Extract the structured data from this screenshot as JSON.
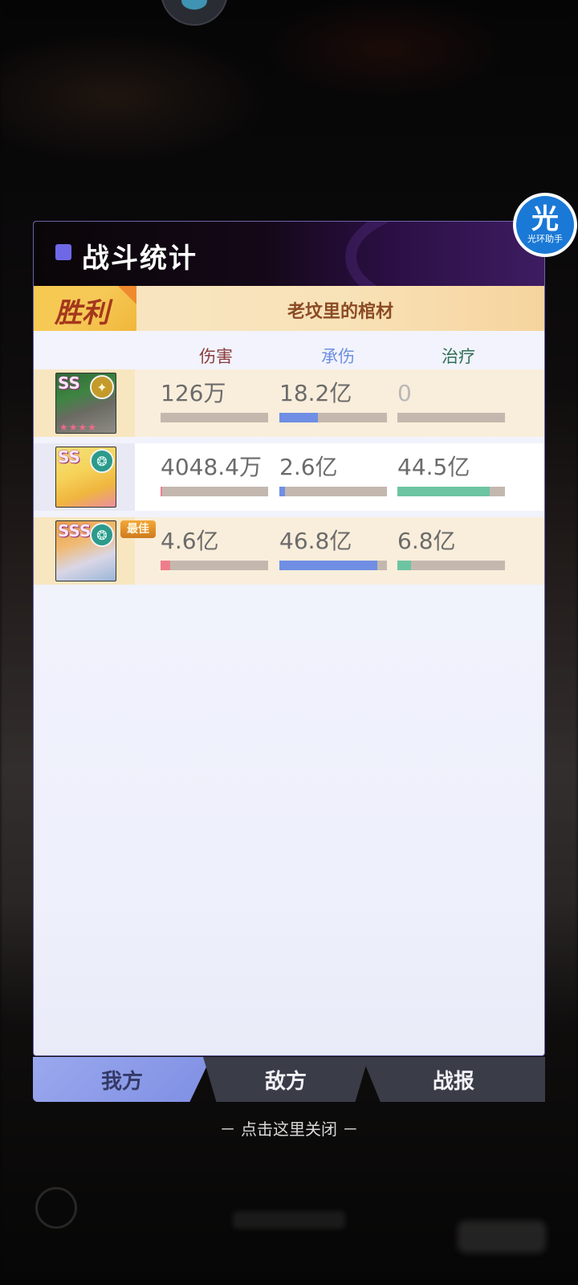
{
  "header": {
    "title": "战斗统计"
  },
  "result": {
    "label": "胜利",
    "opponent": "老坟里的棺材"
  },
  "columns": {
    "damage": "伤害",
    "taken": "承伤",
    "heal": "治疗"
  },
  "colors": {
    "damage_header": "#8b3b3b",
    "taken_header": "#6d8fe0",
    "heal_header": "#2f6e55",
    "damage_bar": "#ee7d8b",
    "taken_bar": "#6f8ee4",
    "heal_bar": "#6dc4a2",
    "bar_track": "#c4b8ae"
  },
  "rows": [
    {
      "rank": "SS",
      "element_icon": "cross-element-icon",
      "stars": "★★★★",
      "damage": "126万",
      "damage_fraction": 0.0,
      "taken": "18.2亿",
      "taken_fraction": 0.36,
      "heal": "0",
      "heal_fraction": 0.0
    },
    {
      "rank": "SS",
      "element_icon": "wind-element-icon",
      "damage": "4048.4万",
      "damage_fraction": 0.01,
      "taken": "2.6亿",
      "taken_fraction": 0.05,
      "heal": "44.5亿",
      "heal_fraction": 0.86
    },
    {
      "rank": "SSS",
      "element_icon": "wind-element-icon",
      "badge": "最佳",
      "damage": "4.6亿",
      "damage_fraction": 0.09,
      "taken": "46.8亿",
      "taken_fraction": 0.91,
      "heal": "6.8亿",
      "heal_fraction": 0.13
    }
  ],
  "tabs": {
    "mine": "我方",
    "enemy": "敌方",
    "report": "战报"
  },
  "close_hint": "－ 点击这里关闭 －",
  "assistant": {
    "big": "光",
    "small": "光环助手"
  }
}
